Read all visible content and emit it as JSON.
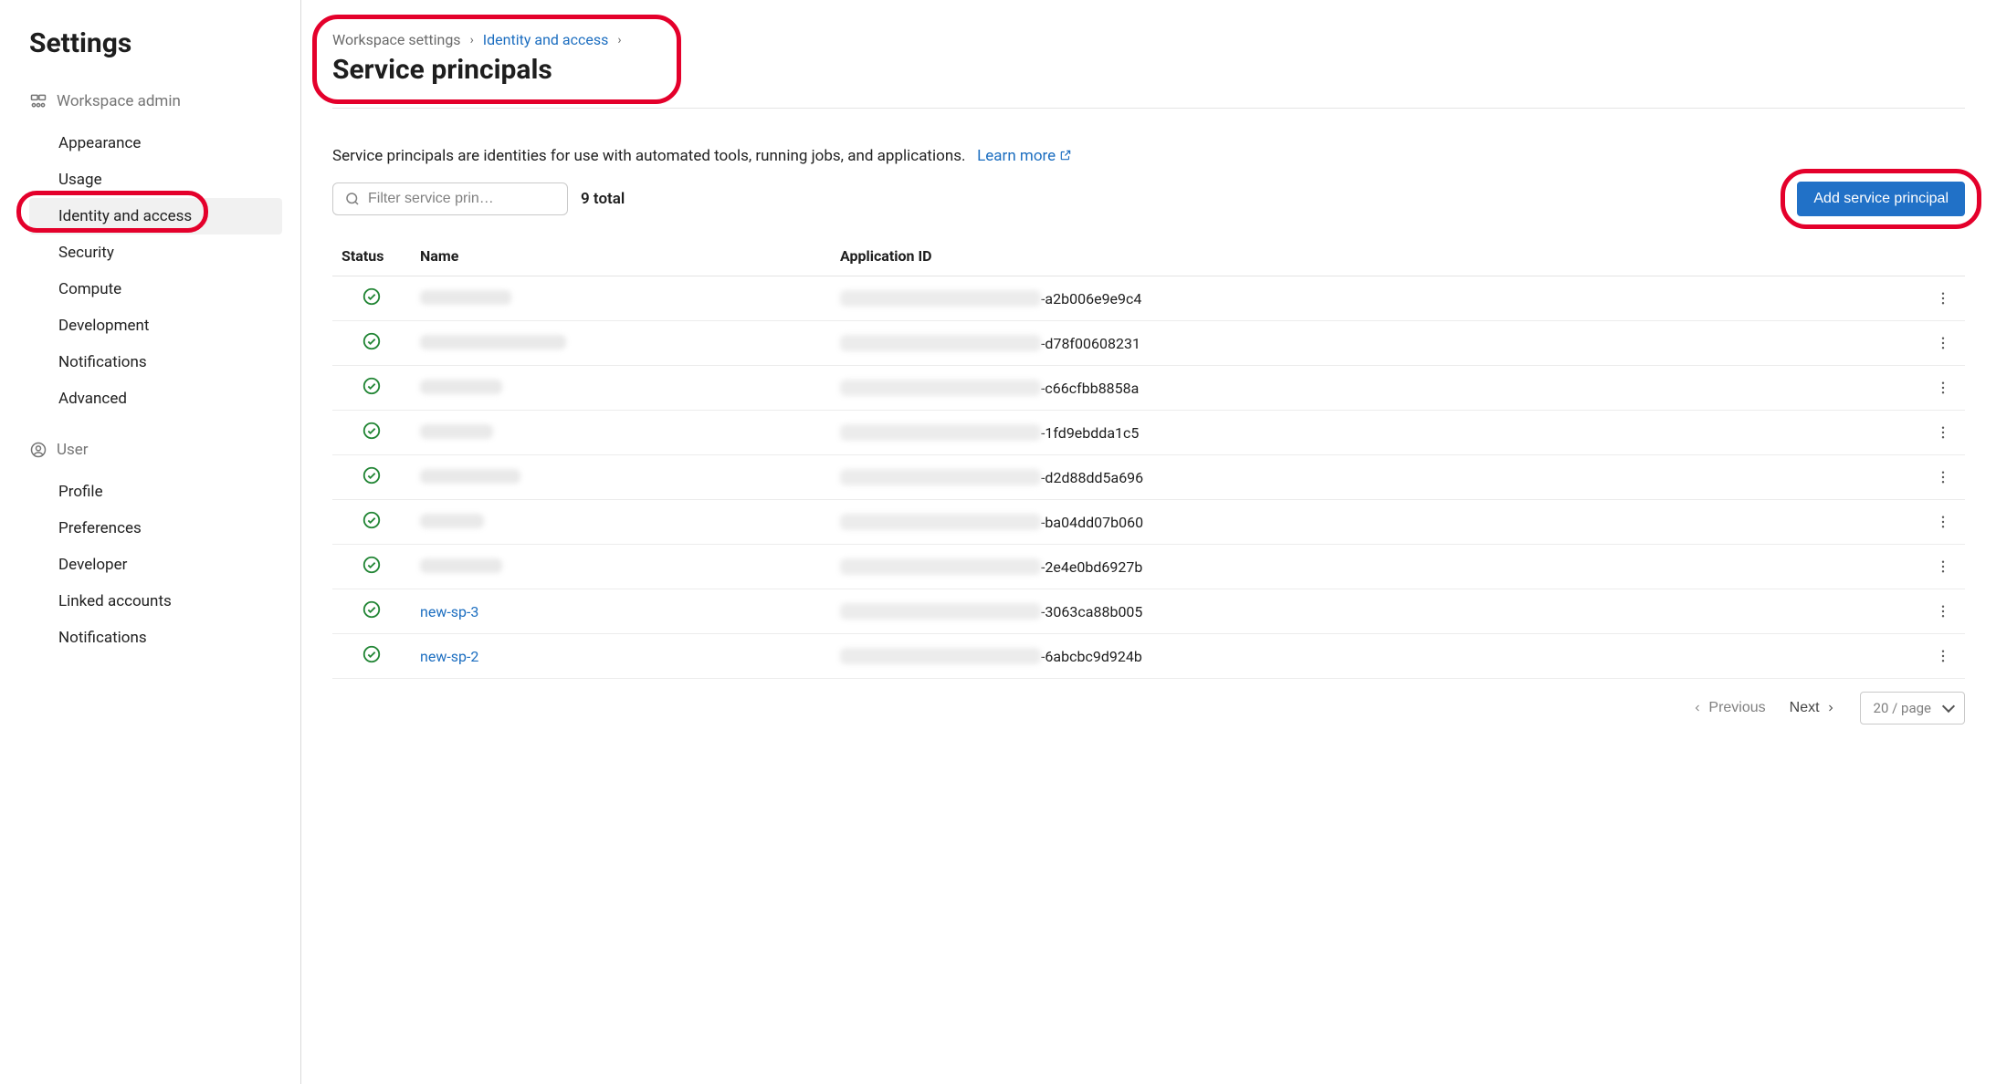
{
  "sidebar": {
    "title": "Settings",
    "sections": [
      {
        "label": "Workspace admin",
        "icon": "workspace-admin-icon",
        "items": [
          {
            "label": "Appearance"
          },
          {
            "label": "Usage"
          },
          {
            "label": "Identity and access",
            "active": true
          },
          {
            "label": "Security"
          },
          {
            "label": "Compute"
          },
          {
            "label": "Development"
          },
          {
            "label": "Notifications"
          },
          {
            "label": "Advanced"
          }
        ]
      },
      {
        "label": "User",
        "icon": "user-icon",
        "items": [
          {
            "label": "Profile"
          },
          {
            "label": "Preferences"
          },
          {
            "label": "Developer"
          },
          {
            "label": "Linked accounts"
          },
          {
            "label": "Notifications"
          }
        ]
      }
    ]
  },
  "breadcrumb": {
    "items": [
      {
        "label": "Workspace settings",
        "link": false
      },
      {
        "label": "Identity and access",
        "link": true
      }
    ]
  },
  "page": {
    "title": "Service principals",
    "description": "Service principals are identities for use with automated tools, running jobs, and applications.",
    "learn_more": "Learn more"
  },
  "toolbar": {
    "filter_placeholder": "Filter service prin…",
    "total_label": "9 total",
    "add_button": "Add service principal"
  },
  "table": {
    "headers": {
      "status": "Status",
      "name": "Name",
      "app_id": "Application ID"
    },
    "rows": [
      {
        "status": "ok",
        "name_hidden": true,
        "name": "",
        "app_id_suffix": "-a2b006e9e9c4"
      },
      {
        "status": "ok",
        "name_hidden": true,
        "name": "",
        "app_id_suffix": "-d78f00608231"
      },
      {
        "status": "ok",
        "name_hidden": true,
        "name": "",
        "app_id_suffix": "-c66cfbb8858a"
      },
      {
        "status": "ok",
        "name_hidden": true,
        "name": "",
        "app_id_suffix": "-1fd9ebdda1c5"
      },
      {
        "status": "ok",
        "name_hidden": true,
        "name": "",
        "app_id_suffix": "-d2d88dd5a696"
      },
      {
        "status": "ok",
        "name_hidden": true,
        "name": "",
        "app_id_suffix": "-ba04dd07b060"
      },
      {
        "status": "ok",
        "name_hidden": true,
        "name": "",
        "app_id_suffix": "-2e4e0bd6927b"
      },
      {
        "status": "ok",
        "name_hidden": false,
        "name": "new-sp-3",
        "app_id_suffix": "-3063ca88b005"
      },
      {
        "status": "ok",
        "name_hidden": false,
        "name": "new-sp-2",
        "app_id_suffix": "-6abcbc9d924b"
      }
    ]
  },
  "pager": {
    "previous": "Previous",
    "next": "Next",
    "page_size": "20 / page"
  }
}
